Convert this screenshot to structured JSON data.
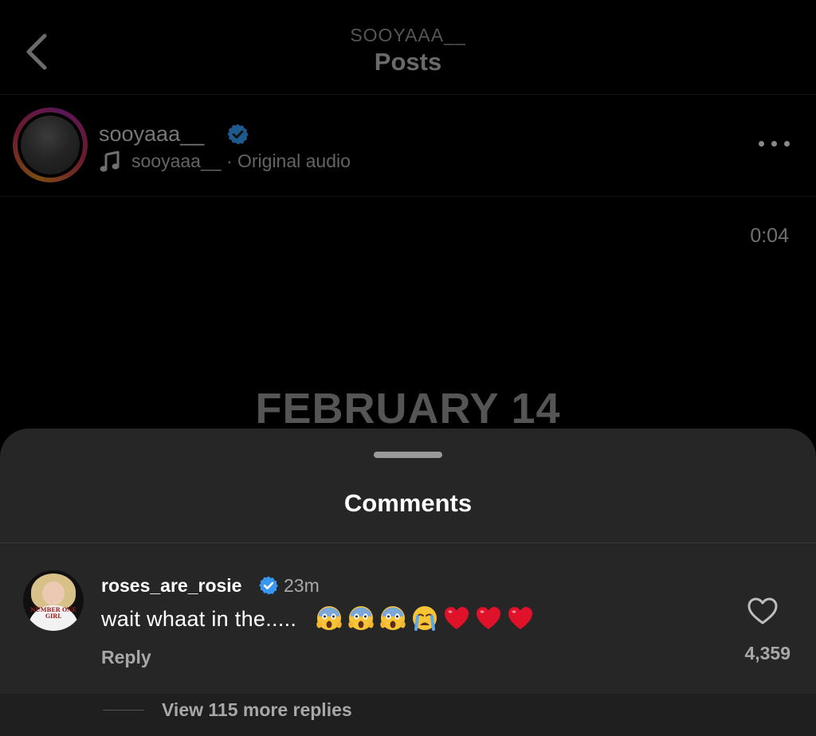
{
  "header": {
    "subtitle": "SOOYAAA__",
    "title": "Posts"
  },
  "post": {
    "author": "sooyaaa__",
    "audio_author": "sooyaaa__",
    "audio_separator": "·",
    "audio_label": "Original audio",
    "timer": "0:04",
    "video_text": "FEBRUARY 14"
  },
  "comments_sheet": {
    "title": "Comments",
    "comment": {
      "username": "roses_are_rosie",
      "time": "23m",
      "text": "wait whaat in the.....",
      "emojis": [
        "scream",
        "scream",
        "scream",
        "sob",
        "red-heart",
        "red-heart",
        "red-heart"
      ],
      "reply_label": "Reply",
      "likes": "4,359",
      "avatar_shirt_text": "NUMBER ONE GIRL"
    },
    "view_replies": "View 115 more replies"
  },
  "colors": {
    "verified": "#3897f0",
    "heart_emoji": "#e0122a",
    "emoji_face": "#f7c337",
    "sheet_bg": "#262626",
    "background": "#000000"
  }
}
